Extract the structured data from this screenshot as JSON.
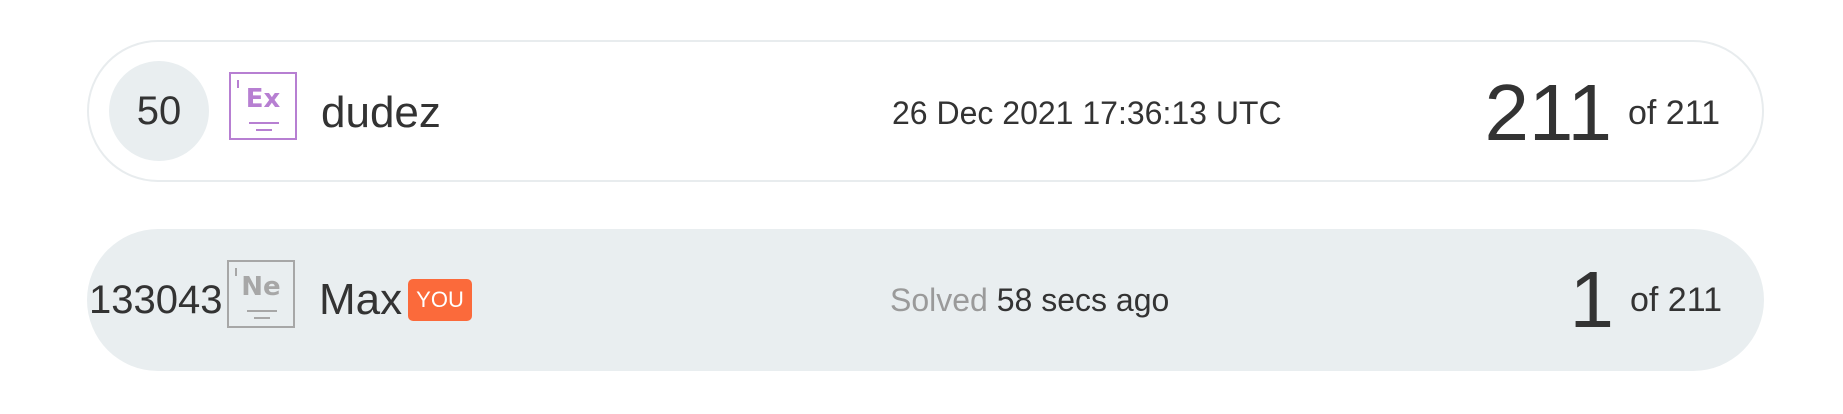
{
  "rows": [
    {
      "rank": "50",
      "badge_symbol": "Ex",
      "badge_icon": "element-badge-icon",
      "badge_color": "#b77fd2",
      "username": "dudez",
      "time_text": "26 Dec 2021 17:36:13 UTC",
      "score": "211",
      "score_total": "of 211"
    },
    {
      "rank": "133043",
      "badge_symbol": "Ne",
      "badge_icon": "element-badge-icon",
      "badge_color": "#a7a7a7",
      "username": "Max",
      "you_label": "YOU",
      "solved_label": "Solved",
      "time_text": "58 secs ago",
      "score": "1",
      "score_total": "of 211"
    }
  ],
  "colors": {
    "row_highlight": "#e9eef0",
    "you_badge": "#fb6a3b"
  }
}
